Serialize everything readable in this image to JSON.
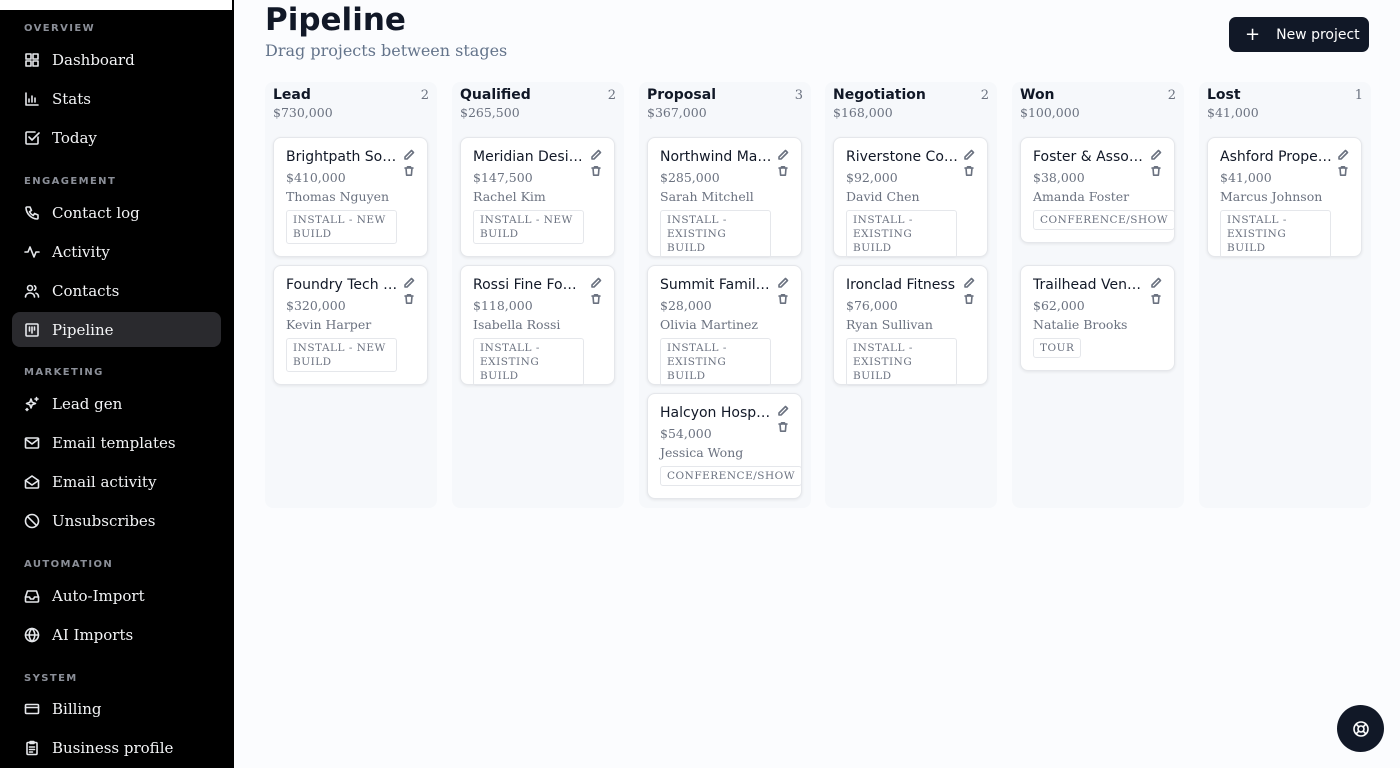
{
  "sidebar": {
    "sections": {
      "overview": "OVERVIEW",
      "engagement": "ENGAGEMENT",
      "marketing": "MARKETING",
      "automation": "AUTOMATION",
      "system": "SYSTEM"
    },
    "items": {
      "dashboard": "Dashboard",
      "stats": "Stats",
      "today": "Today",
      "contact_log": "Contact log",
      "activity": "Activity",
      "contacts": "Contacts",
      "pipeline": "Pipeline",
      "lead_gen": "Lead gen",
      "email_templates": "Email templates",
      "email_activity": "Email activity",
      "unsubscribes": "Unsubscribes",
      "auto_import": "Auto-Import",
      "ai_imports": "AI Imports",
      "billing": "Billing",
      "business_profile": "Business profile"
    },
    "active_item": "Pipeline"
  },
  "header": {
    "title": "Pipeline",
    "subtitle": "Drag projects between stages",
    "new_project_icon": "+",
    "new_project_label": "New project"
  },
  "columns": [
    {
      "name": "Lead",
      "count": "2",
      "total": "$730,000",
      "cards": [
        {
          "title": "Brightpath Software",
          "value": "$410,000",
          "person": "Thomas Nguyen",
          "tag": "INSTALL - NEW BUILD"
        },
        {
          "title": "Foundry Tech Labs",
          "value": "$320,000",
          "person": "Kevin Harper",
          "tag": "INSTALL - NEW BUILD"
        }
      ]
    },
    {
      "name": "Qualified",
      "count": "2",
      "total": "$265,500",
      "cards": [
        {
          "title": "Meridian Design",
          "value": "$147,500",
          "person": "Rachel Kim",
          "tag": "INSTALL - NEW BUILD"
        },
        {
          "title": "Rossi Fine Foods",
          "value": "$118,000",
          "person": "Isabella Rossi",
          "tag": "INSTALL - EXISTING BUILD"
        }
      ]
    },
    {
      "name": "Proposal",
      "count": "3",
      "total": "$367,000",
      "cards": [
        {
          "title": "Northwind Marketing",
          "value": "$285,000",
          "person": "Sarah Mitchell",
          "tag": "INSTALL - EXISTING BUILD"
        },
        {
          "title": "Summit Family Dental",
          "value": "$28,000",
          "person": "Olivia Martinez",
          "tag": "INSTALL - EXISTING BUILD"
        },
        {
          "title": "Halcyon Hospitality",
          "value": "$54,000",
          "person": "Jessica Wong",
          "tag": "CONFERENCE/SHOW"
        }
      ]
    },
    {
      "name": "Negotiation",
      "count": "2",
      "total": "$168,000",
      "cards": [
        {
          "title": "Riverstone Construction",
          "value": "$92,000",
          "person": "David Chen",
          "tag": "INSTALL - EXISTING BUILD"
        },
        {
          "title": "Ironclad Fitness",
          "value": "$76,000",
          "person": "Ryan Sullivan",
          "tag": "INSTALL - EXISTING BUILD"
        }
      ]
    },
    {
      "name": "Won",
      "count": "2",
      "total": "$100,000",
      "cards": [
        {
          "title": "Foster & Associates",
          "value": "$38,000",
          "person": "Amanda Foster",
          "tag": "CONFERENCE/SHOW"
        },
        {
          "title": "Trailhead Ventures",
          "value": "$62,000",
          "person": "Natalie Brooks",
          "tag": "TOUR"
        }
      ]
    },
    {
      "name": "Lost",
      "count": "1",
      "total": "$41,000",
      "cards": [
        {
          "title": "Ashford Properties",
          "value": "$41,000",
          "person": "Marcus Johnson",
          "tag": "INSTALL - EXISTING BUILD"
        }
      ]
    }
  ],
  "icons": {
    "card_edit": "pencil-icon",
    "card_delete": "trash-icon",
    "help": "lifebuoy-icon"
  },
  "colors": {
    "sidebar_bg": "#000000",
    "accent_dark": "#111827",
    "board_bg": "#f6f8fb"
  }
}
